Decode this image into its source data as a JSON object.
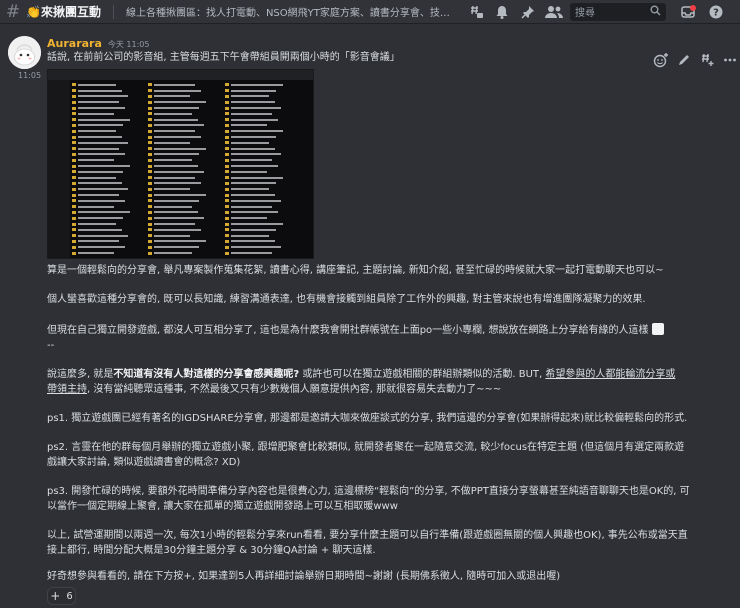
{
  "header": {
    "channel_name": "👏來揪團互動",
    "topic": "線上各種揪團區：找人打電動、NSO網飛YT家庭方案、讀書分享會、技能交換、甚至團…",
    "search_placeholder": "搜尋"
  },
  "message": {
    "author": "Aurarara",
    "timestamp": "今天 11:05",
    "side_timestamp": "11:05",
    "first_line": "話說, 在前前公司的影音組, 主管每週五下午會帶組員開兩個小時的「影音會議」",
    "p1": "算是一個輕鬆向的分享會, 舉凡專案製作蒐集花絮, 讀書心得, 講座筆記, 主題討論, 新知介紹, 甚至忙碌的時候就大家一起打電動聊天也可以~",
    "p2": "個人蠻喜歡這種分享會的, 既可以長知識, 練習溝通表達, 也有機會接觸到組員除了工作外的興趣, 對主管來說也有增進團隊凝聚力的效果.",
    "p3a": "但現在自己獨立開發遊戲, 都沒人可互相分享了, 這也是為什麼我會開社群帳號在上面po一些小專欄, 想說放在網路上分享給有緣的人這樣",
    "p3b": "--",
    "p4_pre": "說這麼多, 就是",
    "p4_bold": "不知道有沒有人對這樣的分享會感興趣呢?",
    "p4_mid": " 或許也可以在獨立遊戲相關的群組辦類似的活動. BUT, ",
    "p4_ul1": "希望參與的人都能輪流分享或",
    "p4_ul2": "帶領主持",
    "p4_end": ", 沒有當純聽眾這種事, 不然最後又只有少數幾個人願意提供內容, 那就很容易失去動力了~~~",
    "ps1": "ps1. 獨立遊戲團已經有著名的IGDSHARE分享會, 那邊都是邀請大咖來做座談式的分享, 我們這邊的分享會(如果辦得起來)就比較偏輕鬆向的形式.",
    "ps2a": "ps2. 言靈在他的群每個月舉辦的獨立遊戲小聚, 跟增肥聚會比較類似, 就開發者聚在一起隨意交流, 較少focus在特定主題 (但這個月有選定兩款遊",
    "ps2b": "戲讓大家討論, 類似遊戲讀書會的概念? XD)",
    "ps3a": "ps3. 開發忙碌的時候, 要額外花時間準備分享內容也是很費心力, 這邊標榜“輕鬆向”的分享, 不做PPT直接分享螢幕甚至純語音聊聊天也是OK的, 可",
    "ps3b": "以當作一個定期線上聚會, 讓大家在孤單的獨立遊戲開發路上可以互相取暖www",
    "p5a": "以上, 試營運期間以兩週一次, 每次1小時的輕鬆分享來run看看, 要分享什麼主題可以自行準備(跟遊戲圈無關的個人興趣也OK), 事先公布或當天直",
    "p5b": "接上都行, 時間分配大概是30分鐘主題分享 & 30分鐘QA討論 + 聊天這樣.",
    "p6": "好奇想參與看看的, 請在下方按+, 如果達到5人再詳細討論舉辦日期時間~謝謝 (長期佛系徵人, 隨時可加入或退出喔)"
  },
  "reaction": {
    "emoji": "+",
    "count": "6"
  },
  "colors": {
    "author": "#f0b232",
    "background": "#313338",
    "text": "#dbdee1",
    "folder": "#d3a934"
  },
  "icons": [
    "hash-icon",
    "threads-icon",
    "bell-icon",
    "pin-icon",
    "members-icon",
    "search-icon",
    "inbox-icon",
    "help-icon",
    "add-reaction-icon",
    "edit-icon",
    "thread-icon",
    "more-icon"
  ]
}
